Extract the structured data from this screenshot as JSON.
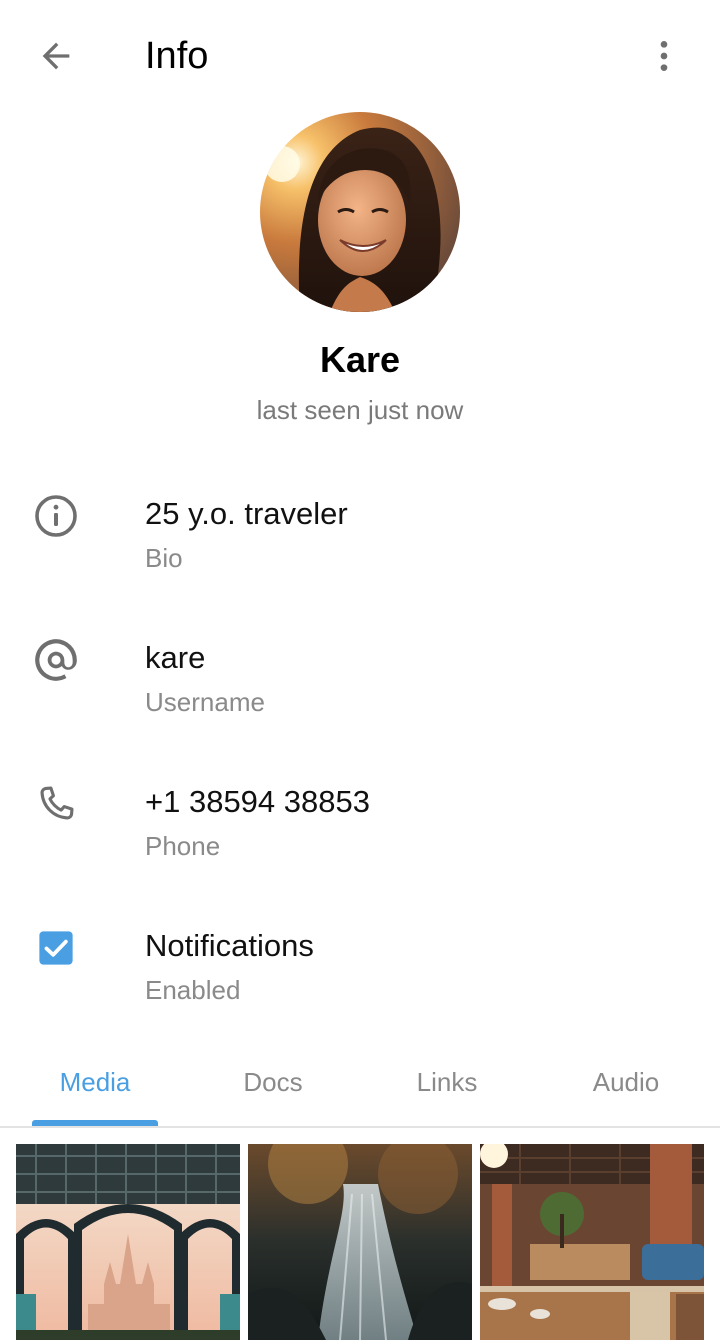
{
  "header": {
    "title": "Info",
    "back_icon": "arrow-left-icon",
    "more_icon": "more-vert-icon"
  },
  "profile": {
    "name": "Kare",
    "status": "last seen just now"
  },
  "info_rows": [
    {
      "icon": "info-icon",
      "value": "25 y.o. traveler",
      "label": "Bio"
    },
    {
      "icon": "at-icon",
      "value": "kare",
      "label": "Username"
    },
    {
      "icon": "phone-icon",
      "value": "+1 38594 38853",
      "label": "Phone"
    },
    {
      "icon": "checkbox-checked-icon",
      "value": "Notifications",
      "label": "Enabled",
      "checked": true
    }
  ],
  "tabs": [
    {
      "label": "Media",
      "active": true
    },
    {
      "label": "Docs",
      "active": false
    },
    {
      "label": "Links",
      "active": false
    },
    {
      "label": "Audio",
      "active": false
    }
  ],
  "media": [
    {
      "subject": "castle-archway-photo"
    },
    {
      "subject": "waterfall-photo"
    },
    {
      "subject": "restaurant-interior-photo"
    }
  ],
  "colors": {
    "accent": "#4a9fe3",
    "icon_gray": "#6f6f6f",
    "secondary_text": "#8a8a8a"
  }
}
